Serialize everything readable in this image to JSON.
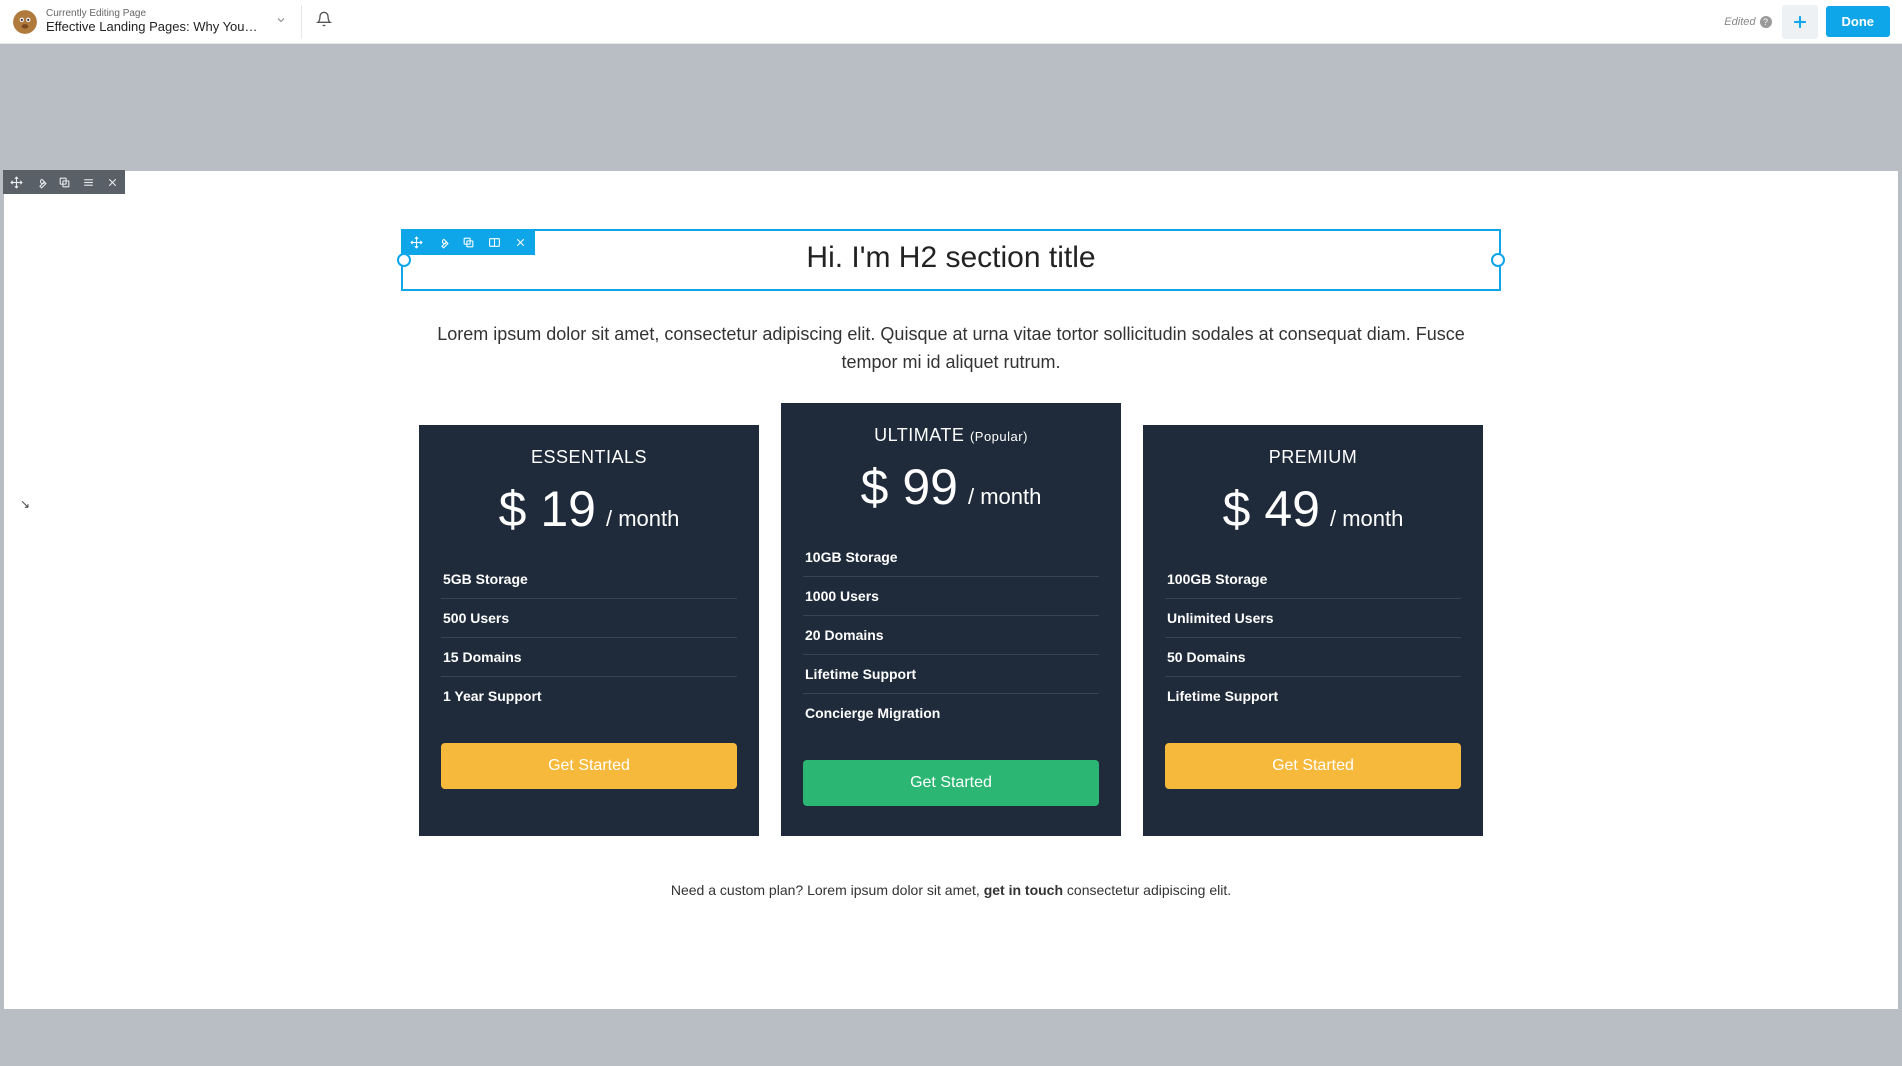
{
  "topbar": {
    "editing_label": "Currently Editing Page",
    "page_title": "Effective Landing Pages: Why You Ne...",
    "edited_label": "Edited",
    "done_label": "Done"
  },
  "section": {
    "title": "Hi. I'm H2 section title",
    "lead": "Lorem ipsum dolor sit amet, consectetur adipiscing elit. Quisque at urna vitae tortor sollicitudin sodales at consequat diam. Fusce tempor mi id aliquet rutrum."
  },
  "pricing": {
    "plans": [
      {
        "name": "ESSENTIALS",
        "sub": "",
        "price": "$ 19",
        "per": "/ month",
        "features": [
          "5GB Storage",
          "500 Users",
          "15 Domains",
          "1 Year Support"
        ],
        "cta": "Get Started",
        "cta_style": "yellow",
        "featured": false
      },
      {
        "name": "ULTIMATE",
        "sub": "(Popular)",
        "price": "$ 99",
        "per": "/ month",
        "features": [
          "10GB Storage",
          "1000 Users",
          "20 Domains",
          "Lifetime Support",
          "Concierge Migration"
        ],
        "cta": "Get Started",
        "cta_style": "green",
        "featured": true
      },
      {
        "name": "PREMIUM",
        "sub": "",
        "price": "$ 49",
        "per": "/ month",
        "features": [
          "100GB Storage",
          "Unlimited Users",
          "50 Domains",
          "Lifetime Support"
        ],
        "cta": "Get Started",
        "cta_style": "yellow",
        "featured": false
      }
    ]
  },
  "footer": {
    "pre": "Need a custom plan? Lorem ipsum dolor sit amet, ",
    "link": "get in touch",
    "post": " consectetur adipiscing elit."
  }
}
